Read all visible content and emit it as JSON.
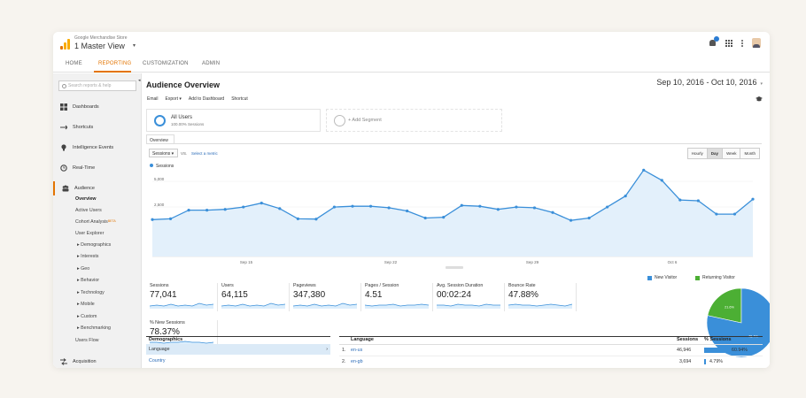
{
  "header": {
    "account_small": "Google Merchandise Store",
    "account_view": "1 Master View",
    "colors": {
      "logo_orange": "#f9ab00",
      "logo_dark": "#e37400",
      "accent": "#e37400",
      "brand_blue": "#2b7cd3"
    }
  },
  "nav": {
    "tabs": [
      "HOME",
      "REPORTING",
      "CUSTOMIZATION",
      "ADMIN"
    ],
    "active": "REPORTING"
  },
  "sidebar": {
    "search_placeholder": "Search reports & help",
    "items": [
      "Dashboards",
      "Shortcuts",
      "Intelligence Events",
      "Real-Time",
      "Audience",
      "Acquisition"
    ],
    "audience_sub": [
      "Overview",
      "Active Users",
      "Cohort Analysis",
      "User Explorer",
      "▸ Demographics",
      "▸ Interests",
      "▸ Geo",
      "▸ Behavior",
      "▸ Technology",
      "▸ Mobile",
      "▸ Custom",
      "▸ Benchmarking",
      "Users Flow"
    ],
    "beta_label": "BETA"
  },
  "main": {
    "title": "Audience Overview",
    "date_range": "Sep 10, 2016 - Oct 10, 2016",
    "actions": [
      "Email",
      "Export ▾",
      "Add to Dashboard",
      "Shortcut"
    ],
    "segment": {
      "name": "All Users",
      "sub": "100.00% Sessions"
    },
    "add_segment": "+ Add Segment",
    "overview_tab": "Overview",
    "metric_select": "Sessions",
    "vs": "VS.",
    "select_metric": "Select a metric",
    "granularity": [
      "Hourly",
      "Day",
      "Week",
      "Month"
    ],
    "granularity_selected": "Day"
  },
  "chart_data": {
    "type": "area",
    "legend": "Sessions",
    "y_ticks": [
      "5,000",
      "2,500"
    ],
    "x_ticks": [
      "Sep 15",
      "Sep 22",
      "Sep 29",
      "Oct 6"
    ],
    "ylim": [
      0,
      5800
    ],
    "values": [
      2350,
      2400,
      2950,
      2950,
      3000,
      3150,
      3400,
      3050,
      2400,
      2380,
      3150,
      3200,
      3200,
      3100,
      2900,
      2450,
      2500,
      3250,
      3200,
      3000,
      3150,
      3100,
      2800,
      2300,
      2450,
      3150,
      3850,
      5500,
      4850,
      3600,
      3550,
      2700,
      2700,
      3650
    ],
    "color": "#3a8fd9"
  },
  "metrics": [
    {
      "label": "Sessions",
      "value": "77,041"
    },
    {
      "label": "Users",
      "value": "64,115"
    },
    {
      "label": "Pageviews",
      "value": "347,380"
    },
    {
      "label": "Pages / Session",
      "value": "4.51"
    },
    {
      "label": "Avg. Session Duration",
      "value": "00:02:24"
    },
    {
      "label": "Bounce Rate",
      "value": "47.88%"
    },
    {
      "label": "% New Sessions",
      "value": "78.37%"
    }
  ],
  "pie": {
    "legend": [
      "New Visitor",
      "Returning Visitor"
    ],
    "values": [
      78.4,
      21.6
    ],
    "labels": [
      "78.4%",
      "21.6%"
    ],
    "colors": [
      "#3a8fd9",
      "#4caf34"
    ]
  },
  "demographics": {
    "header": "Demographics",
    "rows": [
      "Language",
      "Country"
    ],
    "selected": "Language"
  },
  "language_table": {
    "headers": [
      "Language",
      "Sessions",
      "% Sessions"
    ],
    "rows": [
      {
        "rank": "1.",
        "name": "en-us",
        "sessions": "46,946",
        "pct": "60.94%",
        "frac": 0.6094
      },
      {
        "rank": "2.",
        "name": "en-gb",
        "sessions": "3,694",
        "pct": "4.79%",
        "frac": 0.0479
      }
    ]
  }
}
